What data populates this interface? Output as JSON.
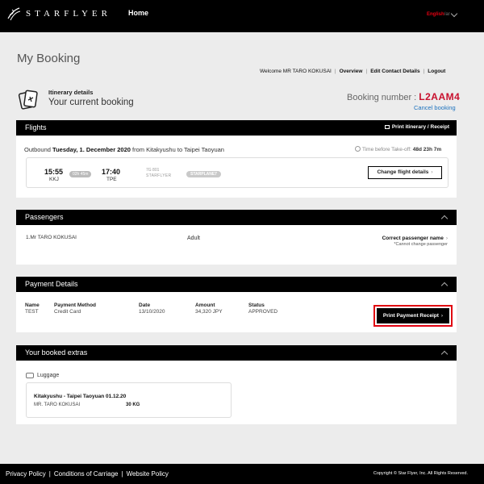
{
  "header": {
    "logo_text": "STARFLYER",
    "logo_icon": "starflyer-logo-icon",
    "nav_home": "Home",
    "language": "English",
    "language_sep": "/ar"
  },
  "page": {
    "title": "My Booking"
  },
  "user_nav": {
    "welcome": "Welcome MR TARO KOKUSAI",
    "overview": "Overview",
    "edit_contact": "Edit Contact Details",
    "logout": "Logout"
  },
  "itinerary": {
    "icon": "ticket-plane-icon",
    "label": "Itinerary details",
    "subtitle": "Your current booking"
  },
  "booking": {
    "number_label": "Booking number :",
    "number": "L2AAM4",
    "cancel": "Cancel booking"
  },
  "flights": {
    "title": "Flights",
    "print_label": "Print itinerary / Receipt",
    "outbound_prefix": "Outbound",
    "outbound_date": "Tuesday, 1. December 2020",
    "outbound_route": "from Kitakyushu to Taipei Taoyuan",
    "time_before_label": "Time before Take-off:",
    "time_before_value": "48d 23h 7m",
    "departure_time": "15:55",
    "departure_code": "KKJ",
    "duration": "02h 45m",
    "arrival_time": "17:40",
    "arrival_code": "TPE",
    "flight_number": "7G 801",
    "carrier": "STARFLYER",
    "aircraft": "STARPLANE7",
    "change_button": "Change flight details"
  },
  "passengers": {
    "title": "Passengers",
    "name": "1.Mr TARO KOKUSAI",
    "type": "Adult",
    "correct_label": "Correct passenger name",
    "note": "*Cannot change passenger"
  },
  "payment": {
    "title": "Payment Details",
    "headers": [
      "Name",
      "Payment Method",
      "Date",
      "Amount",
      "Status"
    ],
    "values": [
      "TEST",
      "Credit Card",
      "13/10/2020",
      "34,320 JPY",
      "APPROVED"
    ],
    "print_button": "Print Payment Receipt"
  },
  "extras": {
    "title": "Your booked extras",
    "luggage_label": "Luggage",
    "route": "Kitakyushu - Taipei Taoyuan 01.12.20",
    "passenger": "MR. TARO KOKUSAI",
    "weight": "30 KG"
  },
  "footer": {
    "privacy": "Privacy Policy",
    "conditions": "Conditions of Carriage",
    "website_policy": "Website Policy",
    "separator": "|",
    "copyright": "Copyright © Star Flyer, Inc. All Rights Reserved."
  },
  "colors": {
    "header_bg": "#000000",
    "booking_code": "#c8102e",
    "link_blue": "#1e73be",
    "highlight": "#e00010"
  }
}
